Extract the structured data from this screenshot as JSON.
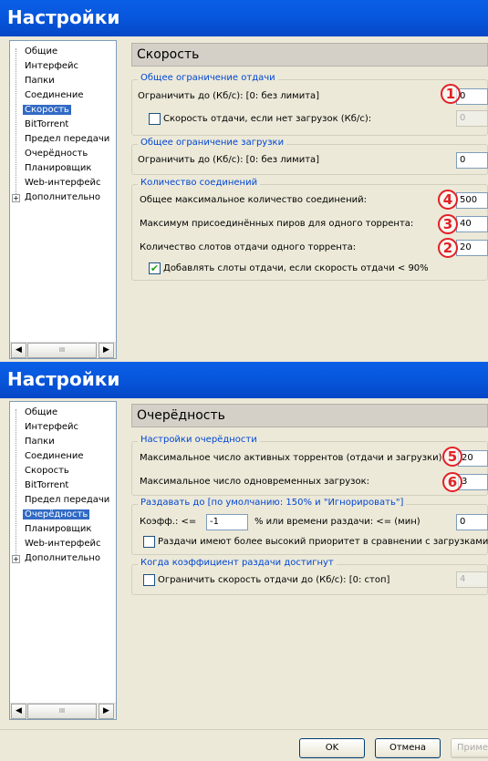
{
  "window1": {
    "title": "Настройки",
    "tree": [
      "Общие",
      "Интерфейс",
      "Папки",
      "Соединение",
      "Скорость",
      "BitTorrent",
      "Предел передачи",
      "Очерёдность",
      "Планировщик",
      "Web-интерфейс",
      "Дополнительно"
    ],
    "selected_index": 4,
    "scroll_thumb": "III",
    "panel_title": "Скорость",
    "upload_group": {
      "legend": "Общее ограничение отдачи",
      "limit_label": "Ограничить до (Кб/с): [0: без лимита]",
      "limit_value": "0",
      "no_dl_label": "Скорость отдачи, если нет загрузок (Кб/с):",
      "no_dl_value": "0",
      "no_dl_checked": false
    },
    "download_group": {
      "legend": "Общее ограничение загрузки",
      "limit_label": "Ограничить до (Кб/с): [0: без лимита]",
      "limit_value": "0"
    },
    "connections_group": {
      "legend": "Количество соединений",
      "max_conn_label": "Общее максимальное количество соединений:",
      "max_conn_value": "500",
      "max_peers_label": "Максимум присоединённых пиров для одного торрента:",
      "max_peers_value": "40",
      "slots_label": "Количество слотов отдачи одного торрента:",
      "slots_value": "20",
      "add_slots_label": "Добавлять слоты отдачи, если скорость отдачи < 90%",
      "add_slots_checked": true
    },
    "badges": [
      "1",
      "4",
      "3",
      "2"
    ]
  },
  "window2": {
    "title": "Настройки",
    "tree": [
      "Общие",
      "Интерфейс",
      "Папки",
      "Соединение",
      "Скорость",
      "BitTorrent",
      "Предел передачи",
      "Очерёдность",
      "Планировщик",
      "Web-интерфейс",
      "Дополнительно"
    ],
    "selected_index": 7,
    "scroll_thumb": "III",
    "panel_title": "Очерёдность",
    "queue_group": {
      "legend": "Настройки очерёдности",
      "active_label": "Максимальное число активных торрентов (отдачи и загрузки):",
      "active_value": "20",
      "downloads_label": "Максимальное число одновременных загрузок:",
      "downloads_value": "3"
    },
    "seed_group": {
      "legend": "Раздавать до   [по умолчанию: 150% и \"Игнорировать\"]",
      "coef_label": "Коэфф.: <=",
      "coef_value": "-1",
      "time_label": "% или времени раздачи: <= (мин)",
      "time_value": "0",
      "priority_label": "Раздачи имеют более высокий приоритет в сравнении с загрузками",
      "priority_checked": false
    },
    "reached_group": {
      "legend": "Когда коэффициент раздачи достигнут",
      "limit_label": "Ограничить скорость отдачи до (Кб/с): [0: стоп]",
      "limit_value": "4",
      "limit_checked": false
    },
    "badges": [
      "5",
      "6"
    ],
    "buttons": {
      "ok": "OK",
      "cancel": "Отмена",
      "apply": "Приме"
    }
  },
  "colors": {
    "title_blue": "#0757dd",
    "legend_blue": "#0046d5",
    "selection": "#316ac5",
    "badge_red": "#e32027"
  }
}
